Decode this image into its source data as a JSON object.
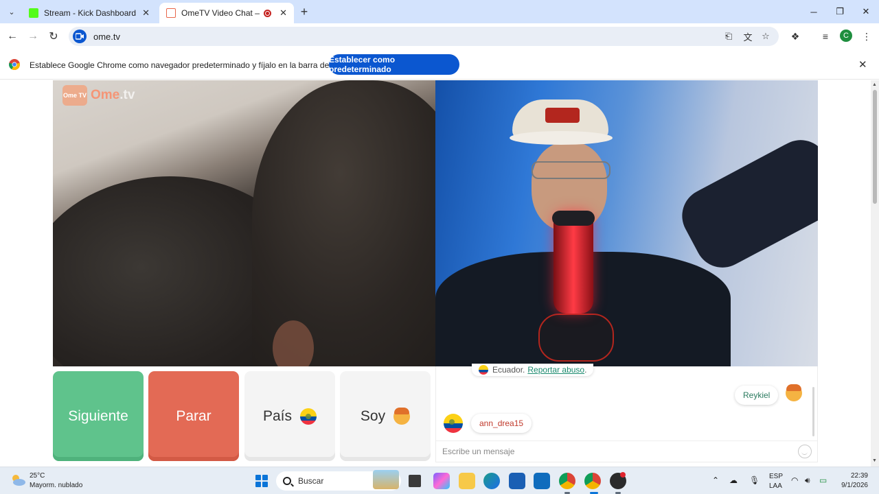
{
  "browser": {
    "tabs": [
      {
        "title": "Stream - Kick Dashboard",
        "favicon_color": "#53fc18",
        "active": false
      },
      {
        "title": "OmeTV Video Chat — Ome",
        "favicon_color": "#e8664a",
        "active": true
      }
    ],
    "url": "ome.tv",
    "infobar": {
      "text": "Establece Google Chrome como navegador predeterminado y fíjalo en la barra de tareas",
      "button": "Establecer como predeterminado"
    },
    "accent": "#0b57d0",
    "profile_initial": "C"
  },
  "site": {
    "logo_box": "Ome TV",
    "logo_text_main": "Ome",
    "logo_text_suffix": ".tv",
    "buttons": {
      "next": "Siguiente",
      "stop": "Parar",
      "country": "País",
      "me": "Soy"
    },
    "colors": {
      "next": "#5fc38c",
      "stop": "#e36a55"
    },
    "chat": {
      "system_country": "Ecuador.",
      "system_link": "Reportar abuso",
      "system_suffix": ".",
      "my_name": "Reykiel",
      "partner_name": "ann_drea15",
      "input_placeholder": "Escribe un mensaje"
    }
  },
  "taskbar": {
    "weather_temp": "25°C",
    "weather_desc": "Mayorm. nublado",
    "search_label": "Buscar",
    "lang_top": "ESP",
    "lang_bottom": "LAA",
    "time": "22:39",
    "date": "9/1/2026"
  }
}
